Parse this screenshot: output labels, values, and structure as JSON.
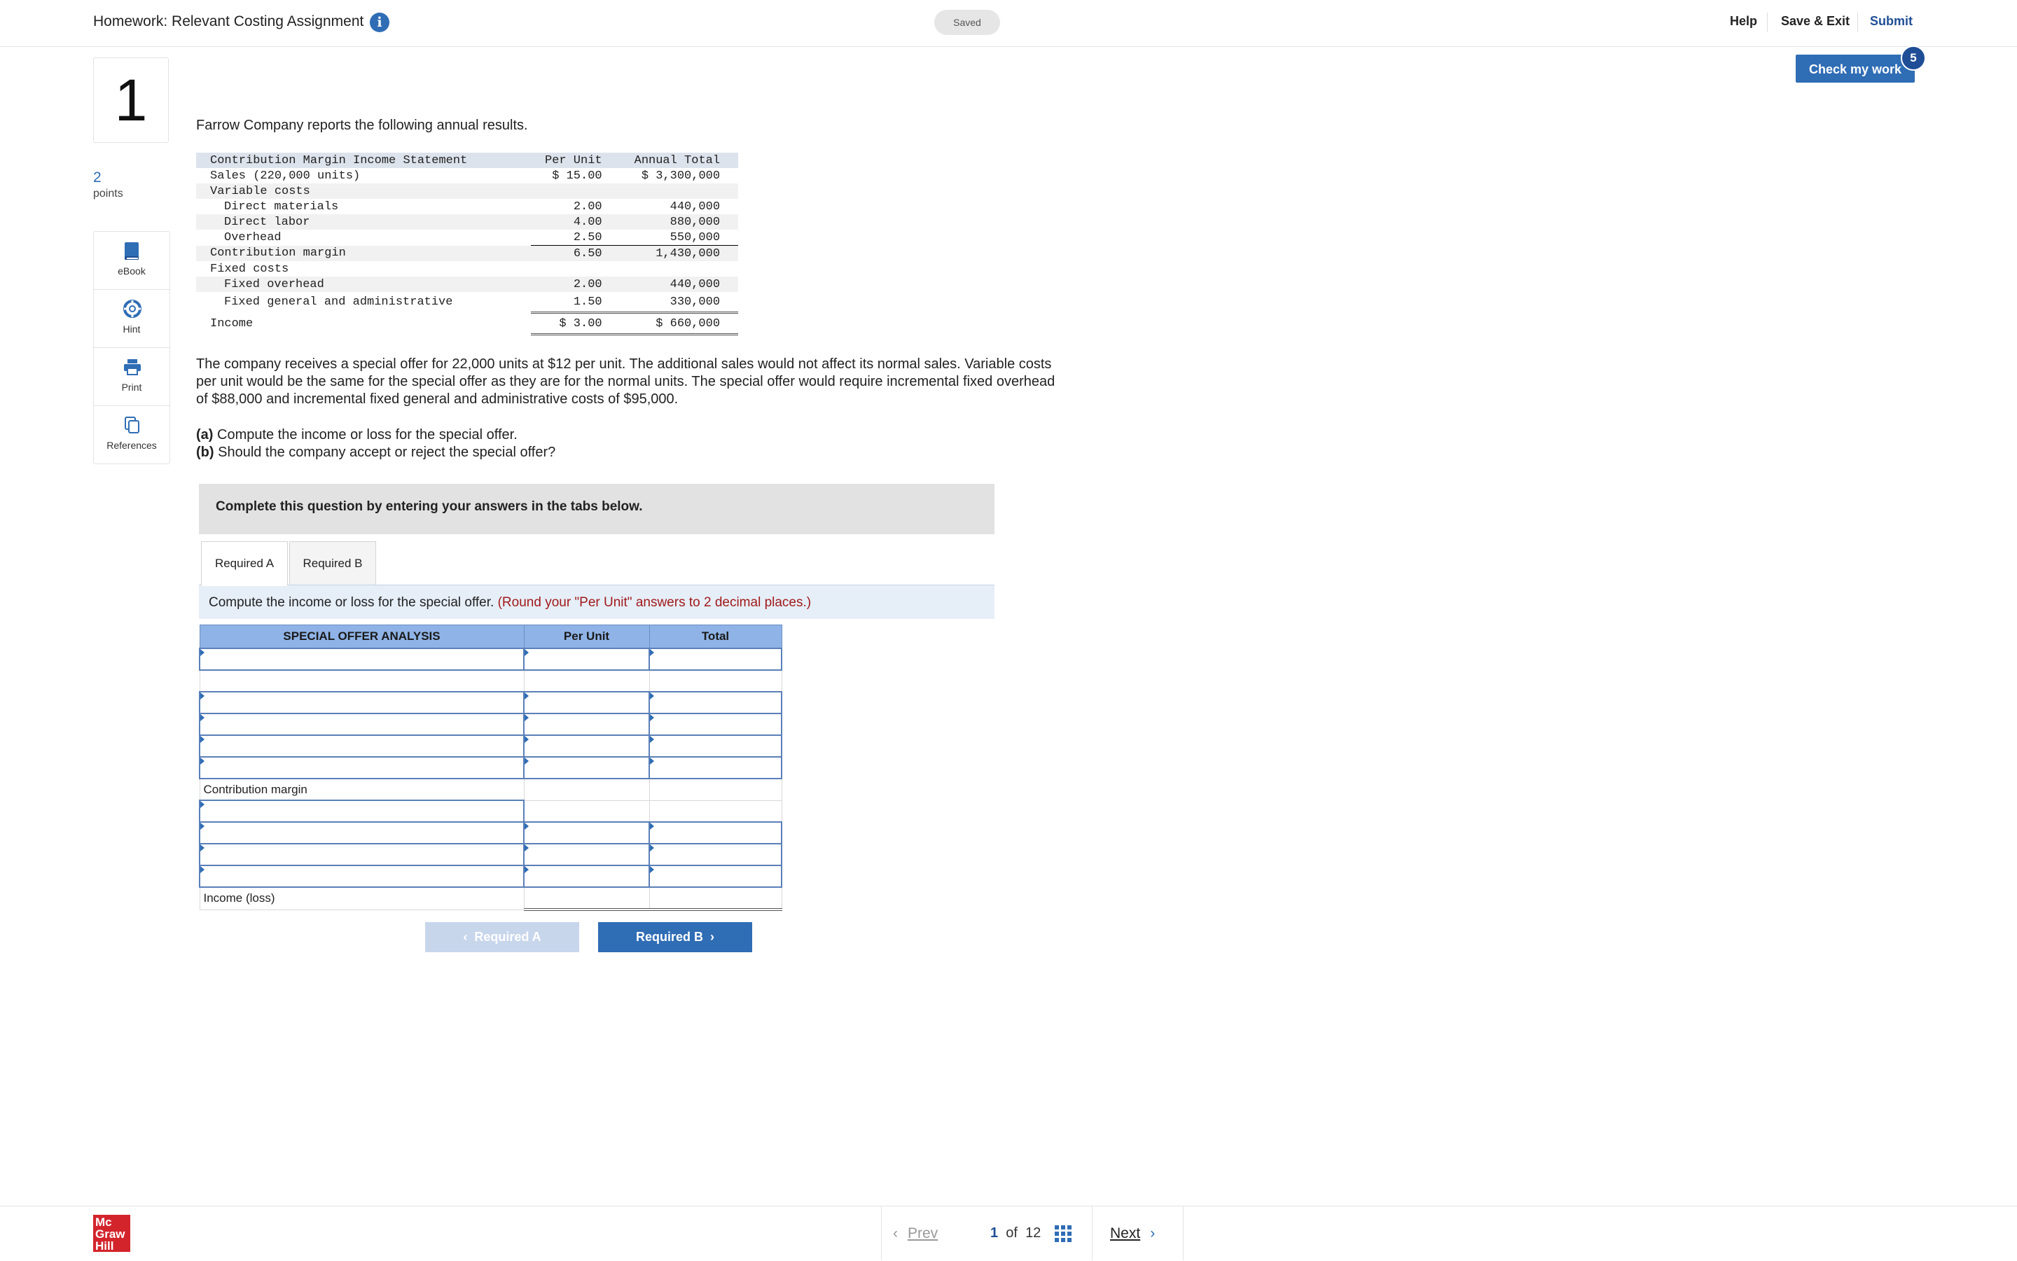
{
  "header": {
    "title": "Homework: Relevant Costing Assignment",
    "info_glyph": "i",
    "saved": "Saved",
    "help": "Help",
    "save_exit": "Save & Exit",
    "submit": "Submit",
    "check_my_work": "Check my work",
    "check_badge": "5"
  },
  "question": {
    "number": "1",
    "points_value": "2",
    "points_label": "points"
  },
  "tools": [
    {
      "label": "eBook",
      "icon": "book-icon"
    },
    {
      "label": "Hint",
      "icon": "lifebuoy-icon"
    },
    {
      "label": "Print",
      "icon": "printer-icon"
    },
    {
      "label": "References",
      "icon": "documents-icon"
    }
  ],
  "intro": "Farrow Company reports the following annual results.",
  "income_statement": {
    "headers": [
      "Contribution Margin Income Statement",
      "Per Unit",
      "Annual Total"
    ],
    "rows": [
      {
        "label": "Sales (220,000 units)",
        "per_unit": "$ 15.00",
        "total": "$ 3,300,000"
      },
      {
        "label": "Variable costs",
        "per_unit": "",
        "total": ""
      },
      {
        "label": "Direct materials",
        "per_unit": "2.00",
        "total": "440,000"
      },
      {
        "label": "Direct labor",
        "per_unit": "4.00",
        "total": "880,000"
      },
      {
        "label": "Overhead",
        "per_unit": "2.50",
        "total": "550,000"
      },
      {
        "label": "Contribution margin",
        "per_unit": "6.50",
        "total": "1,430,000"
      },
      {
        "label": "Fixed costs",
        "per_unit": "",
        "total": ""
      },
      {
        "label": "Fixed overhead",
        "per_unit": "2.00",
        "total": "440,000"
      },
      {
        "label": "Fixed general and administrative",
        "per_unit": "1.50",
        "total": "330,000"
      },
      {
        "label": "Income",
        "per_unit": "$ 3.00",
        "total": "$ 660,000"
      }
    ]
  },
  "paragraph": "The company receives a special offer for 22,000 units at $12 per unit. The additional sales would not affect its normal sales. Variable costs per unit would be the same for the special offer as they are for the normal units. The special offer would require incremental fixed overhead of $88,000 and incremental fixed general and administrative costs of $95,000.",
  "parts": {
    "a_label": "(a)",
    "a_text": " Compute the income or loss for the special offer.",
    "b_label": "(b)",
    "b_text": " Should the company accept or reject the special offer?"
  },
  "complete_box": "Complete this question by entering your answers in the tabs below.",
  "tabs": [
    "Required A",
    "Required B"
  ],
  "instruction": {
    "text": "Compute the income or loss for the special offer. ",
    "round_note": "(Round your \"Per Unit\" answers to 2 decimal places.)"
  },
  "analysis": {
    "headers": [
      "SPECIAL OFFER ANALYSIS",
      "Per Unit",
      "Total"
    ],
    "contribution_margin": "Contribution margin",
    "income_loss": "Income (loss)"
  },
  "nav_buttons": {
    "prev_req": "Required A",
    "next_req": "Required B"
  },
  "footer": {
    "logo_line1": "Mc",
    "logo_line2": "Graw",
    "logo_line3": "Hill",
    "prev": "Prev",
    "current_page": "1",
    "of": "of",
    "total_pages": "12",
    "next": "Next"
  }
}
